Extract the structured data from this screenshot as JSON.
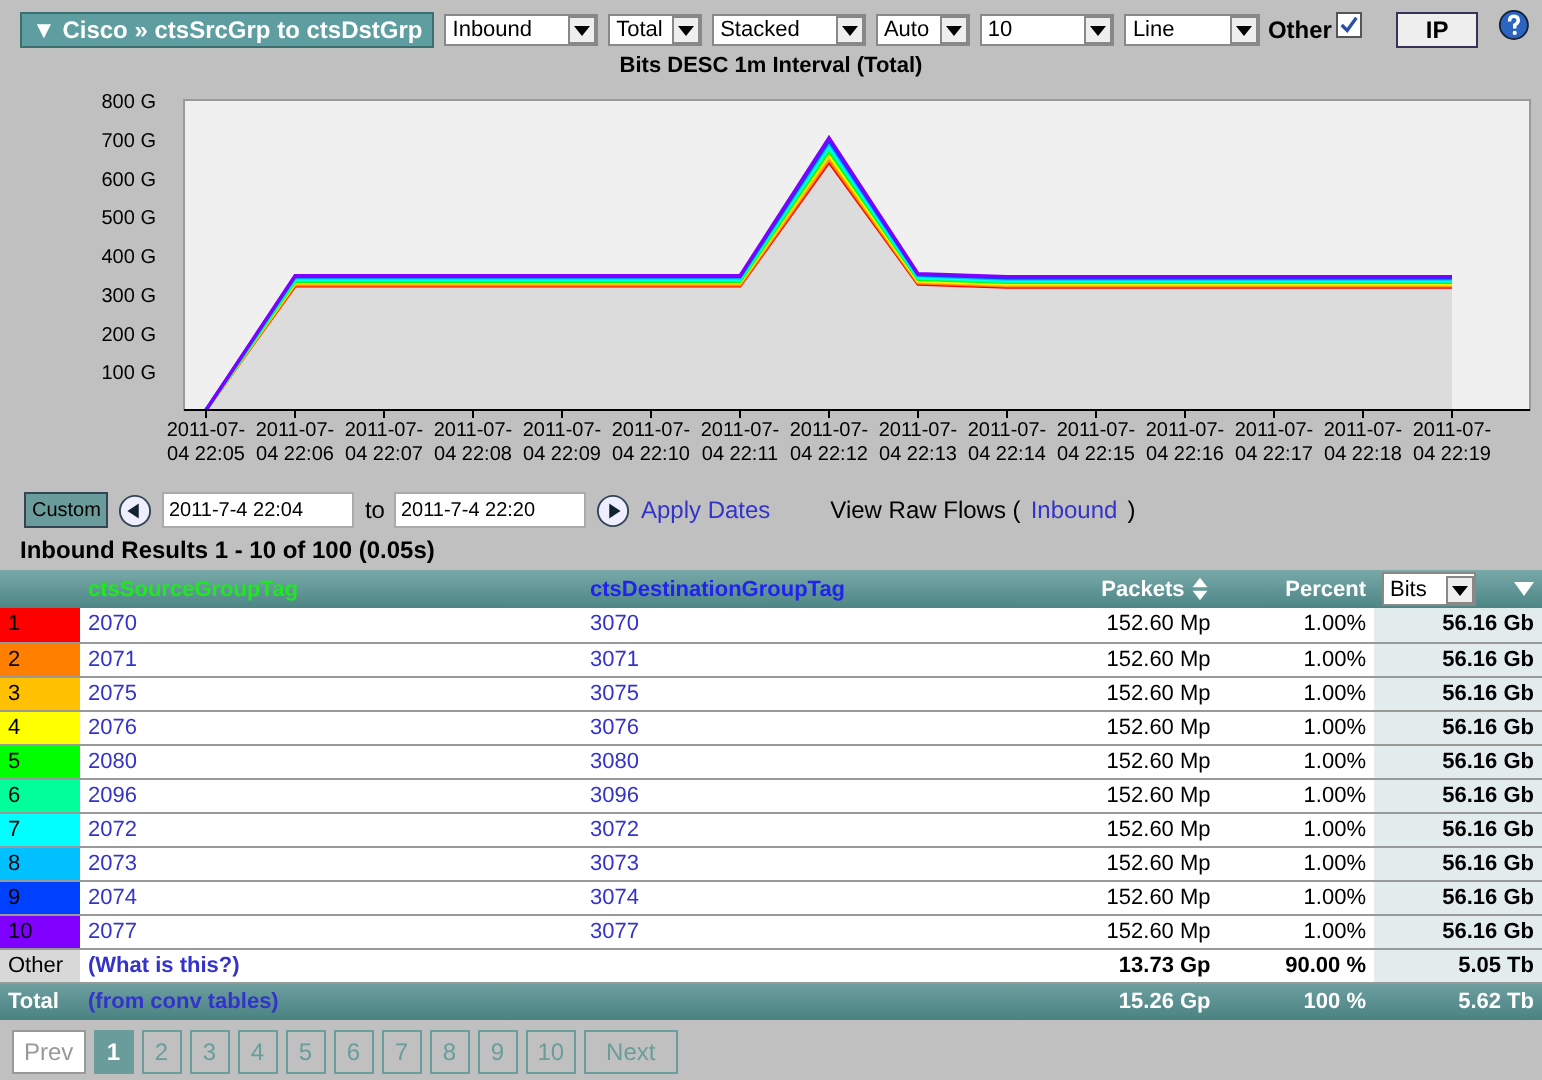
{
  "toolbar": {
    "title": "▼ Cisco » ctsSrcGrp to ctsDstGrp",
    "selects": [
      {
        "value": "Inbound"
      },
      {
        "value": "Total"
      },
      {
        "value": "Stacked"
      },
      {
        "value": "Auto"
      },
      {
        "value": "10"
      },
      {
        "value": "Line"
      }
    ],
    "other": {
      "label": "Other",
      "checked": true
    },
    "ip_button": "IP"
  },
  "chart": {
    "chart_data": {
      "type": "line",
      "title": "Bits DESC 1m Interval (Total)",
      "categories": [
        "2011-07-04 22:05",
        "2011-07-04 22:06",
        "2011-07-04 22:07",
        "2011-07-04 22:08",
        "2011-07-04 22:09",
        "2011-07-04 22:10",
        "2011-07-04 22:11",
        "2011-07-04 22:12",
        "2011-07-04 22:13",
        "2011-07-04 22:14",
        "2011-07-04 22:15",
        "2011-07-04 22:16",
        "2011-07-04 22:17",
        "2011-07-04 22:18",
        "2011-07-04 22:19"
      ],
      "ylim": [
        0,
        800
      ],
      "yticks": [
        {
          "value": 100,
          "label": "100 G"
        },
        {
          "value": 200,
          "label": "200 G"
        },
        {
          "value": 300,
          "label": "300 G"
        },
        {
          "value": 400,
          "label": "400 G"
        },
        {
          "value": 500,
          "label": "500 G"
        },
        {
          "value": 600,
          "label": "600 G"
        },
        {
          "value": 700,
          "label": "700 G"
        },
        {
          "value": 800,
          "label": "800 G"
        }
      ],
      "series": [
        {
          "color": "#ff0000",
          "values": [
            0,
            320,
            320,
            320,
            320,
            320,
            320,
            640,
            325,
            317,
            317,
            317,
            317,
            317,
            317
          ]
        },
        {
          "color": "#ff8000",
          "values": [
            0,
            323,
            323,
            323,
            323,
            323,
            323,
            647,
            328,
            320,
            320,
            320,
            320,
            320,
            320
          ]
        },
        {
          "color": "#ffc000",
          "values": [
            0,
            326,
            326,
            326,
            326,
            326,
            326,
            654,
            331,
            323,
            323,
            323,
            323,
            323,
            323
          ]
        },
        {
          "color": "#ffff00",
          "values": [
            0,
            329,
            329,
            329,
            329,
            329,
            329,
            661,
            334,
            326,
            326,
            326,
            326,
            326,
            326
          ]
        },
        {
          "color": "#00ff00",
          "values": [
            0,
            332,
            332,
            332,
            332,
            332,
            332,
            668,
            337,
            329,
            329,
            329,
            329,
            329,
            329
          ]
        },
        {
          "color": "#00ff99",
          "values": [
            0,
            335,
            335,
            335,
            335,
            335,
            335,
            675,
            340,
            332,
            332,
            332,
            332,
            332,
            332
          ]
        },
        {
          "color": "#00ffff",
          "values": [
            0,
            338,
            338,
            338,
            338,
            338,
            338,
            682,
            343,
            335,
            335,
            335,
            335,
            335,
            335
          ]
        },
        {
          "color": "#00c0ff",
          "values": [
            0,
            341,
            341,
            341,
            341,
            341,
            341,
            689,
            346,
            338,
            338,
            338,
            338,
            338,
            338
          ]
        },
        {
          "color": "#0040ff",
          "values": [
            0,
            344,
            344,
            344,
            344,
            344,
            344,
            696,
            349,
            341,
            341,
            341,
            341,
            341,
            341
          ]
        },
        {
          "color": "#8000ff",
          "values": [
            0,
            347,
            347,
            347,
            347,
            347,
            347,
            703,
            352,
            344,
            344,
            344,
            344,
            344,
            344
          ]
        }
      ]
    }
  },
  "dates": {
    "custom_button": "Custom",
    "from": "2011-7-4 22:04",
    "to_label": "to",
    "to": "2011-7-4 22:20",
    "apply": "Apply Dates",
    "raw_flows_label": "View Raw Flows (",
    "raw_flows_link": "Inbound",
    "raw_flows_end": ")"
  },
  "results_title": "Inbound Results 1 - 10 of 100 (0.05s)",
  "table": {
    "columns": [
      "ctsSourceGroupTag",
      "ctsDestinationGroupTag",
      "Packets",
      "Percent"
    ],
    "unit_select": "Bits",
    "rows": [
      {
        "rank": "1",
        "color": "#ff0000",
        "source": "2070",
        "destination": "3070",
        "packets": "152.60 Mp",
        "percent": "1.00%",
        "bits": "56.16 Gb"
      },
      {
        "rank": "2",
        "color": "#ff8000",
        "source": "2071",
        "destination": "3071",
        "packets": "152.60 Mp",
        "percent": "1.00%",
        "bits": "56.16 Gb"
      },
      {
        "rank": "3",
        "color": "#ffc000",
        "source": "2075",
        "destination": "3075",
        "packets": "152.60 Mp",
        "percent": "1.00%",
        "bits": "56.16 Gb"
      },
      {
        "rank": "4",
        "color": "#ffff00",
        "source": "2076",
        "destination": "3076",
        "packets": "152.60 Mp",
        "percent": "1.00%",
        "bits": "56.16 Gb"
      },
      {
        "rank": "5",
        "color": "#00ff00",
        "source": "2080",
        "destination": "3080",
        "packets": "152.60 Mp",
        "percent": "1.00%",
        "bits": "56.16 Gb"
      },
      {
        "rank": "6",
        "color": "#00ff99",
        "source": "2096",
        "destination": "3096",
        "packets": "152.60 Mp",
        "percent": "1.00%",
        "bits": "56.16 Gb"
      },
      {
        "rank": "7",
        "color": "#00ffff",
        "source": "2072",
        "destination": "3072",
        "packets": "152.60 Mp",
        "percent": "1.00%",
        "bits": "56.16 Gb"
      },
      {
        "rank": "8",
        "color": "#00c0ff",
        "source": "2073",
        "destination": "3073",
        "packets": "152.60 Mp",
        "percent": "1.00%",
        "bits": "56.16 Gb"
      },
      {
        "rank": "9",
        "color": "#0040ff",
        "source": "2074",
        "destination": "3074",
        "packets": "152.60 Mp",
        "percent": "1.00%",
        "bits": "56.16 Gb"
      },
      {
        "rank": "10",
        "color": "#8000ff",
        "source": "2077",
        "destination": "3077",
        "packets": "152.60 Mp",
        "percent": "1.00%",
        "bits": "56.16 Gb"
      }
    ],
    "other_row": {
      "label": "Other",
      "link": "(What is this?)",
      "packets": "13.73 Gp",
      "percent": "90.00 %",
      "bits": "5.05 Tb"
    },
    "total_row": {
      "label": "Total",
      "link": "(from conv tables)",
      "packets": "15.26 Gp",
      "percent": "100 %",
      "bits": "5.62 Tb"
    }
  },
  "pagination": [
    {
      "label": "Prev",
      "kind": "nav",
      "selected": false
    },
    {
      "label": "1",
      "kind": "page",
      "selected": true
    },
    {
      "label": "2",
      "kind": "page",
      "selected": false
    },
    {
      "label": "3",
      "kind": "page",
      "selected": false
    },
    {
      "label": "4",
      "kind": "page",
      "selected": false
    },
    {
      "label": "5",
      "kind": "page",
      "selected": false
    },
    {
      "label": "6",
      "kind": "page",
      "selected": false
    },
    {
      "label": "7",
      "kind": "page",
      "selected": false
    },
    {
      "label": "8",
      "kind": "page",
      "selected": false
    },
    {
      "label": "9",
      "kind": "page",
      "selected": false
    },
    {
      "label": "10",
      "kind": "page",
      "selected": false
    },
    {
      "label": "Next",
      "kind": "nav-end",
      "selected": false
    }
  ]
}
